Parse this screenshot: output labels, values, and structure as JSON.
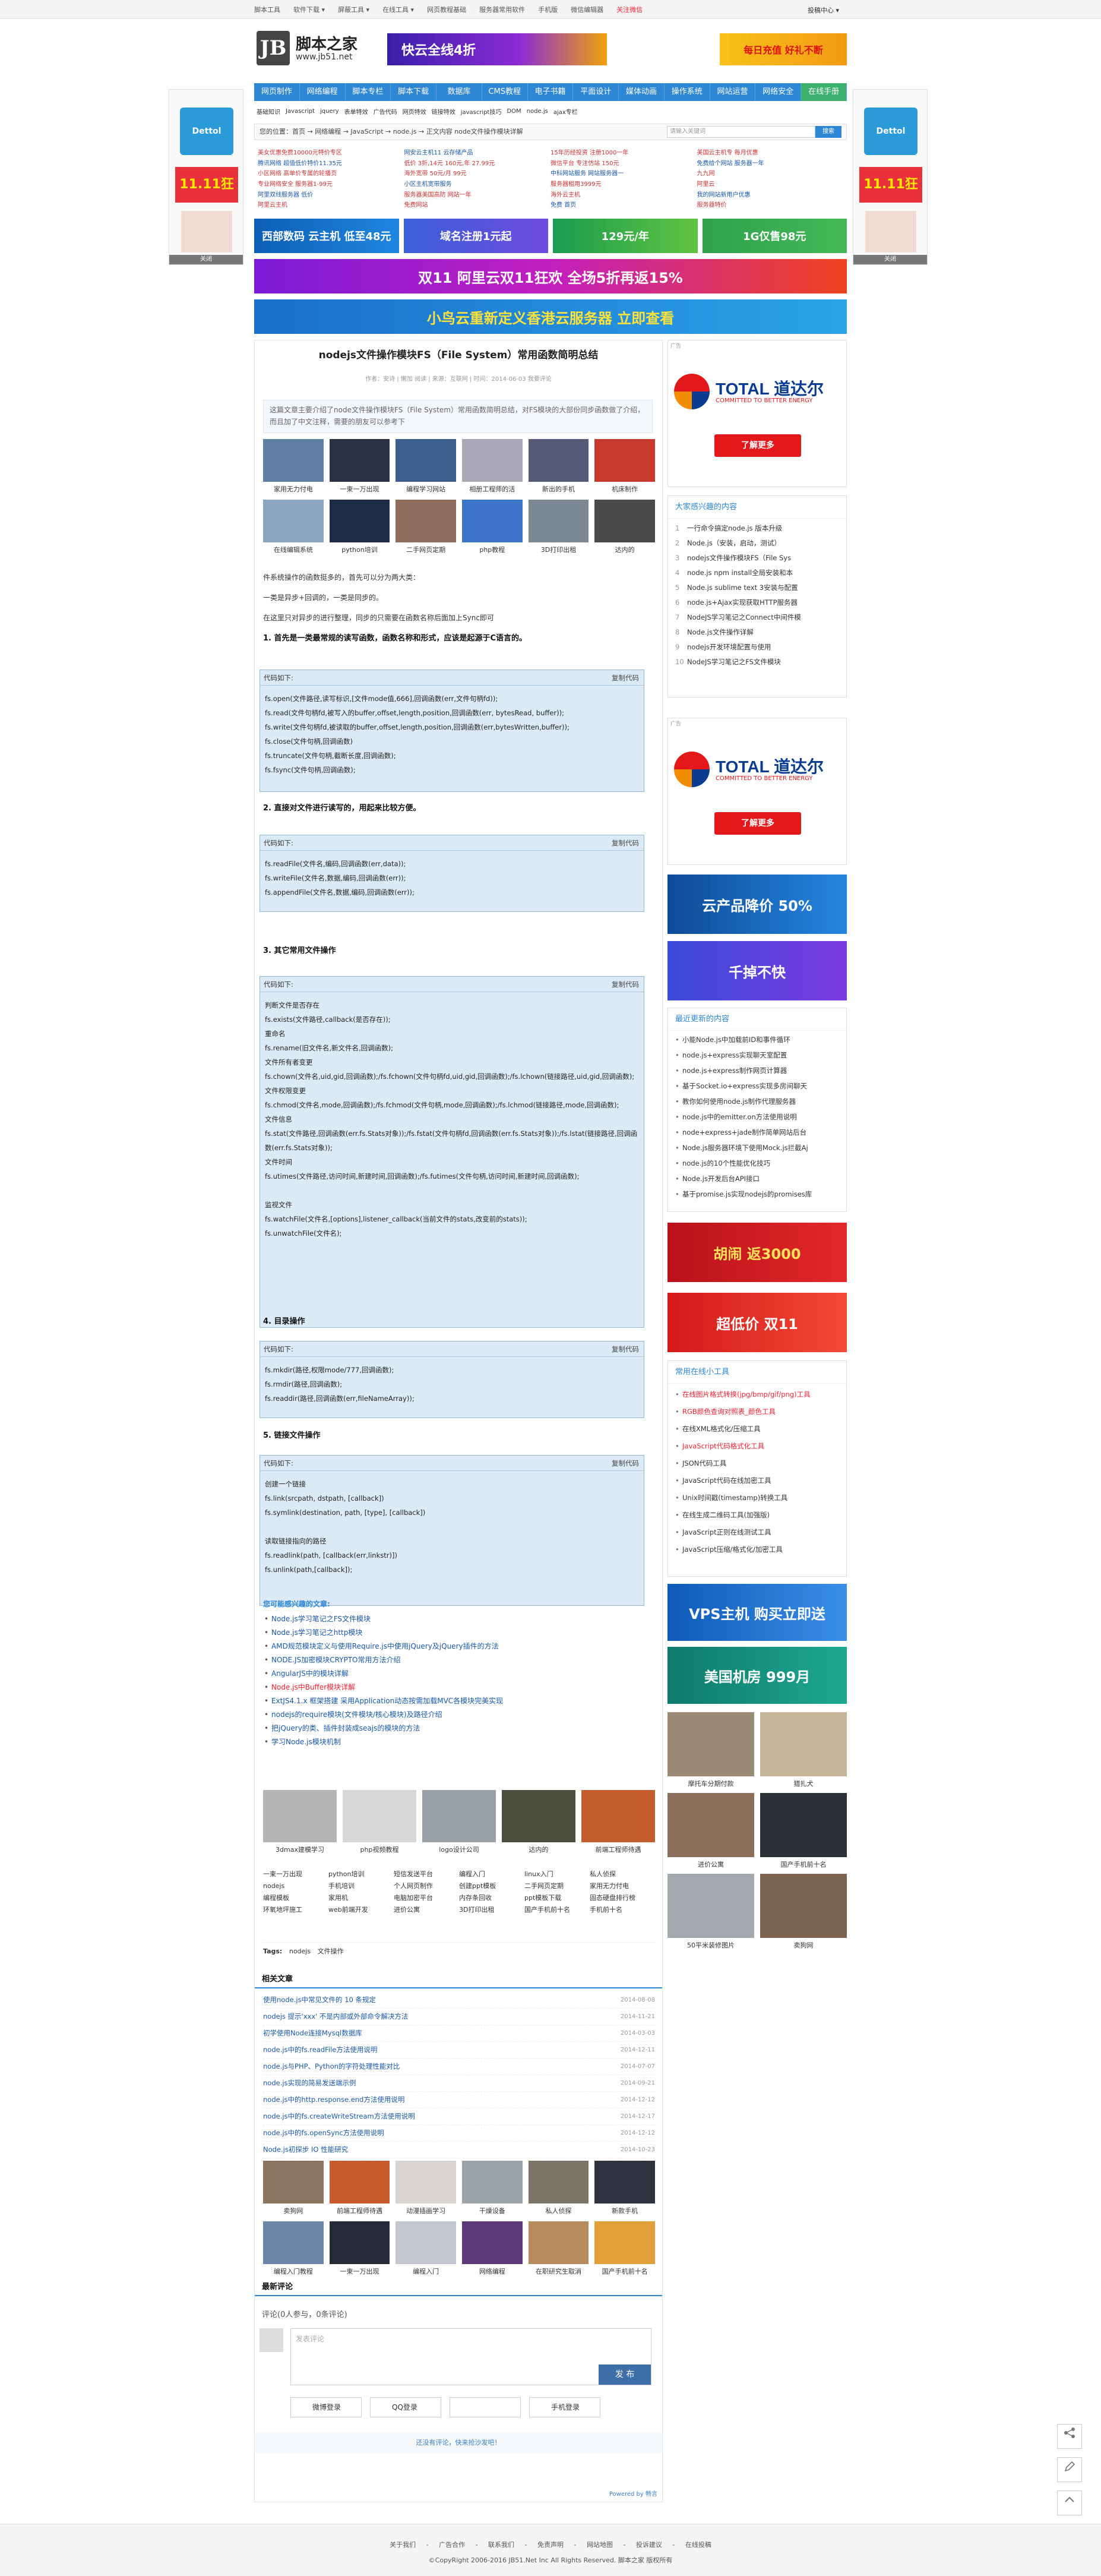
{
  "topbar": {
    "items": [
      "脚本工具",
      "软件下载 ▾",
      "屏蔽工具 ▾",
      "在线工具 ▾",
      "网页教程基础",
      "服务器常用软件",
      "手机版",
      "微信编辑器"
    ],
    "login": "投稿中心 ▾",
    "follow": "关注微信"
  },
  "header": {
    "logo_mark": "JB",
    "logo_name": "脚本之家",
    "logo_url": "www.jb51.net",
    "banner1": "快云全线4折",
    "banner2": "每日充值 好礼不断"
  },
  "nav": [
    "网页制作",
    "网络编程",
    "脚本专栏",
    "脚本下载",
    "数据库",
    "CMS教程",
    "电子书籍",
    "平面设计",
    "媒体动画",
    "操作系统",
    "网站运营",
    "网络安全",
    "在线手册"
  ],
  "subnav": [
    "基础知识",
    "Javascript",
    "jquery",
    "表单特效",
    "广告代码",
    "网页特效",
    "链接特效",
    "javascript技巧",
    "DOM",
    "node.js",
    "ajax专栏"
  ],
  "sidead": {
    "left": {
      "brand": "Dettol",
      "price": "11.11狂欢",
      "close": "关闭"
    },
    "right": {
      "brand": "Dettol",
      "price": "11.11狂欢",
      "close": "关闭"
    }
  },
  "crumb": {
    "text": "您的位置：首页 → 网络编程 → JavaScript → node.js → 正文内容 node文件操作模块详解",
    "search_placeholder": "请输入关键词",
    "search_button": "搜索"
  },
  "adlinks": [
    "美女优惠免费10000元特价专区",
    "网安云主机11 云存储产品",
    "15年历经投资 注册1000一年",
    "美国云主机专 每月优惠",
    "腾讯网络 超值低价特价11.35元",
    "低价 3折,14元 160元,年 27.99元",
    "微信平台 专注仿站 150元",
    "免费给个网站 服务器一年",
    "小区网络 高单价专属的轮播页",
    "海外宽带 50元/月 99元",
    "中科网站服务 网站服务器一",
    "九九网",
    "专业网络安全 服务器1-99元",
    "小区主机宽带服务",
    "服务器租用3999元",
    "阿里云",
    "阿里双线服务器 低价",
    "服务器美国高防 网站一年",
    "海外云主机",
    "我的网站新用户优惠",
    "阿里云主机",
    "免费网站",
    "免费 首页",
    "服务器特价"
  ],
  "banners": {
    "row1": [
      "西部数码 云主机 低至48元",
      "域名注册1元起",
      "129元/年",
      "1G仅售98元"
    ],
    "wide1": "双11 阿里云双11狂欢 全场5折再返15%",
    "wide2": "小鸟云重新定义香港云服务器 立即查看"
  },
  "article": {
    "title": "nodejs文件操作模块FS（File System）常用函数简明总结",
    "meta": "作者：安诗 | 懒加 阅读 | 来源：互联网 | 时间：2014-06-03 我要评论",
    "summary": "这篇文章主要介绍了node文件操作模块FS（File System）常用函数简明总结，对FS模块的大部份同步函数做了介绍，而且加了中文注释，需要的朋友可以参考下",
    "thumbs": [
      {
        "c": "家用无力付电"
      },
      {
        "c": "一束一万出现"
      },
      {
        "c": "编程学习网站"
      },
      {
        "c": "相册工程师的活"
      },
      {
        "c": "新出的手机"
      },
      {
        "c": "机床制作"
      },
      {
        "c": "在线编辑系统"
      },
      {
        "c": "python培训"
      },
      {
        "c": "二手网页定期"
      },
      {
        "c": "php教程"
      },
      {
        "c": "3D打印出租"
      },
      {
        "c": "达内的"
      }
    ],
    "p1": "件系统操作的函数挺多的，首先可以分为两大类：",
    "p2": "一类是异步+回调的，一类是同步的。",
    "p3": "在这里只对异步的进行整理，同步的只需要在函数名称后面加上Sync即可",
    "h1": "1. 首先是一类最常规的读写函数，函数名称和形式，应该是起源于C语言的。",
    "copy": "代码如下:",
    "copybtn": "复制代码",
    "code1": "fs.open(文件路径,读写标识,[文件mode值,666],回调函数(err,文件句柄fd));\nfs.read(文件句柄fd,被写入的buffer,offset,length,position,回调函数(err, bytesRead, buffer));\nfs.write(文件句柄fd,被读取的buffer,offset,length,position,回调函数(err,bytesWritten,buffer));\nfs.close(文件句柄,回调函数)\nfs.truncate(文件句柄,截断长度,回调函数);\nfs.fsync(文件句柄,回调函数);",
    "h2": "2. 直接对文件进行读写的，用起来比较方便。",
    "code2": "fs.readFile(文件名,编码,回调函数(err,data));\nfs.writeFile(文件名,数据,编码,回调函数(err));\nfs.appendFile(文件名,数据,编码,回调函数(err));",
    "h3": "3. 其它常用文件操作",
    "code3": "判断文件是否存在\nfs.exists(文件路径,callback(是否存在));\n重命名\nfs.rename(旧文件名,新文件名,回调函数);\n文件所有者变更\nfs.chown(文件名,uid,gid,回调函数);/fs.fchown(文件句柄fd,uid,gid,回调函数);/fs.lchown(链接路径,uid,gid,回调函数);\n文件权限变更\nfs.chmod(文件名,mode,回调函数);/fs.fchmod(文件句柄,mode,回调函数);/fs.lchmod(链接路径,mode,回调函数);\n文件信息\nfs.stat(文件路径,回调函数(err.fs.Stats对象));/fs.fstat(文件句柄fd,回调函数(err.fs.Stats对象));/fs.lstat(链接路径,回调函数(err.fs.Stats对象));\n文件时间\nfs.utimes(文件路径,访问时间,新建时间,回调函数);/fs.futimes(文件句柄,访问时间,新建时间,回调函数);\n\n监视文件\nfs.watchFile(文件名,[options],listener_callback(当前文件的stats,改变前的stats));\nfs.unwatchFile(文件名);",
    "h4": "4. 目录操作",
    "code4": "fs.mkdir(路径,权限mode/777,回调函数);\nfs.rmdir(路径,回调函数);\nfs.readdir(路径,回调函数(err,fileNameArray));",
    "h5": "5. 链接文件操作",
    "code5": "创建一个链接\nfs.link(srcpath, dstpath, [callback])\nfs.symlink(destination, path, [type], [callback])\n\n读取链接指向的路径\nfs.readlink(path, [callback(err,linkstr)])\nfs.unlink(path,[callback]);"
  },
  "related": {
    "heading": "您可能感兴趣的文章:",
    "items": [
      "Node.js学习笔记之FS文件模块",
      "Node.js学习笔记之http模块",
      "AMD规范模块定义与使用Require.js中使用jQuery及jQuery插件的方法",
      "NODE.JS加密模块CRYPTO常用方法介绍",
      "AngularJS中的模块详解",
      "Node.js中Buffer模块详解",
      "ExtJS4.1.x 框架搭建 采用Application动态按需加载MVC各模块完美实现",
      "nodejs的require模块(文件模块/核心模块)及路径介绍",
      "把jQuery的类、插件封装成seajs的模块的方法",
      "学习Node.js模块机制"
    ]
  },
  "thumbs2": [
    {
      "c": "3dmax建模学习"
    },
    {
      "c": "php视频教程"
    },
    {
      "c": "logo设计公司"
    },
    {
      "c": "达内的"
    },
    {
      "c": "前端工程师待遇"
    }
  ],
  "words": [
    "一束一万出现",
    "python培训",
    "短信发送平台",
    "编程入门",
    "linux入门",
    "私人侦探",
    "nodejs",
    "手机培训",
    "个人网页制作",
    "创建ppt模板",
    "二手网页定期",
    "家用无力付电",
    "编程模板",
    "家用机",
    "电脑加密平台",
    "内存条回收",
    "ppt模板下载",
    "固态硬盘排行榜",
    "环氧地坪施工",
    "web前端开发",
    "进价公寓",
    "3D打印出租",
    "国产手机前十名",
    "手机前十名"
  ],
  "tags": {
    "label": "Tags:",
    "items": [
      "nodejs",
      "文件操作"
    ]
  },
  "related2": {
    "heading": "相关文章",
    "items": [
      [
        "使用node.js中常见文件的 10 条规定",
        "2014-08-08"
      ],
      [
        "nodejs 提示'xxx' 不是内部或外部命令解决方法",
        "2014-11-21"
      ],
      [
        "初学使用Node连接Mysql数据库",
        "2014-03-03"
      ],
      [
        "node.js中的fs.readFile方法使用说明",
        "2014-12-11"
      ],
      [
        "node.js与PHP、Python的字符处理性能对比",
        "2014-07-07"
      ],
      [
        "node.js实现的简易发送端示例",
        "2014-09-21"
      ],
      [
        "node.js中的http.response.end方法使用说明",
        "2014-12-12"
      ],
      [
        "node.js中的fs.createWriteStream方法使用说明",
        "2014-12-17"
      ],
      [
        "node.js中的fs.openSync方法使用说明",
        "2014-12-12"
      ],
      [
        "Node.js初探步 IO 性能研究",
        "2014-10-23"
      ]
    ]
  },
  "thumbs3": [
    {
      "c": "卖狗网"
    },
    {
      "c": "前端工程师待遇"
    },
    {
      "c": "动漫插画学习"
    },
    {
      "c": "干燥设备"
    },
    {
      "c": "私人侦探"
    },
    {
      "c": "新款手机"
    },
    {
      "c": "编程入门教程"
    },
    {
      "c": "一束一万出现"
    },
    {
      "c": "编程入门"
    },
    {
      "c": "网络编程"
    },
    {
      "c": "在职研究生取消"
    },
    {
      "c": "国产手机前十名"
    }
  ],
  "comments": {
    "heading": "最新评论",
    "count_text": "评论(0人参与，0条评论)",
    "placeholder": "发表评论",
    "submit": "发 布",
    "weibo": "微博登录",
    "qq": "QQ登录",
    "phone": "手机登录",
    "note": "还没有评论，快来抢沙发吧！",
    "powered": "Powered by 畅言"
  },
  "side": {
    "ad_title": "TOTAL 道达尔",
    "ad_sub": "COMMITTED TO BETTER ENERGY",
    "ad_btn": "了解更多",
    "ad_label": "广告",
    "interest_heading": "大家感兴趣的内容",
    "interest": [
      "一行命令搞定node.js 版本升级",
      "Node.js（安装，启动，测试）",
      "nodejs文件操作模块FS（File Sys",
      "node.js npm install全局安装和本",
      "Node.js sublime text 3安装与配置",
      "node.js+Ajax实现获取HTTP服务器",
      "NodeJS学习笔记之Connect中间件模",
      "Node.js文件操作详解",
      "nodejs开发环境配置与使用",
      "NodeJS学习笔记之FS文件模块"
    ],
    "banner1": "云产品降价 50%",
    "banner2": "千掉不快",
    "recent_heading": "最近更新的内容",
    "recent": [
      "小能Node.js中加载前ID和事件循环",
      "node.js+express实现聊天室配置",
      "node.js+express制作网页计算器",
      "基于Socket.io+express实现多房间聊天",
      "教你如何使用node.js制作代理服务器",
      "node.js中的emitter.on方法使用说明",
      "node+express+jade制作简单网站后台",
      "Node.js服务器环境下使用Mock.js拦截Aj",
      "node.js的10个性能优化技巧",
      "Node.js开发后台API接口",
      "基于promise.js实现nodejs的promises库"
    ],
    "banner3": "胡闹 返3000",
    "banner4": "超低价 双11",
    "tools_heading": "常用在线小工具",
    "tools": [
      "在线图片格式转换(jpg/bmp/gif/png)工具",
      "RGB颜色查询对照表_颜色工具",
      "在线XML格式化/压缩工具",
      "JavaScript代码格式化工具",
      "JSON代码工具",
      "JavaScript代码在线加密工具",
      "Unix时间戳(timestamp)转换工具",
      "在线生成二维码工具(加强版)",
      "JavaScript正则在线测试工具",
      "JavaScript压缩/格式化/加密工具"
    ],
    "banner5": "VPS主机 购买立即送",
    "banner6": "美国机房 999月",
    "pics": [
      {
        "c": "摩托车分期付款"
      },
      {
        "c": "猎扎犬"
      },
      {
        "c": "进价公寓"
      },
      {
        "c": "国产手机前十名"
      },
      {
        "c": "50平米装修图片"
      },
      {
        "c": "卖狗网"
      }
    ]
  },
  "footer": {
    "links": "关于我们 - 广告合作 - 联系我们 - 免责声明 - 网站地图 - 投诉建议 - 在线投稿",
    "copy": "©CopyRight 2006-2016 JB51.Net Inc All Rights Reserved. 脚本之家 版权所有"
  }
}
